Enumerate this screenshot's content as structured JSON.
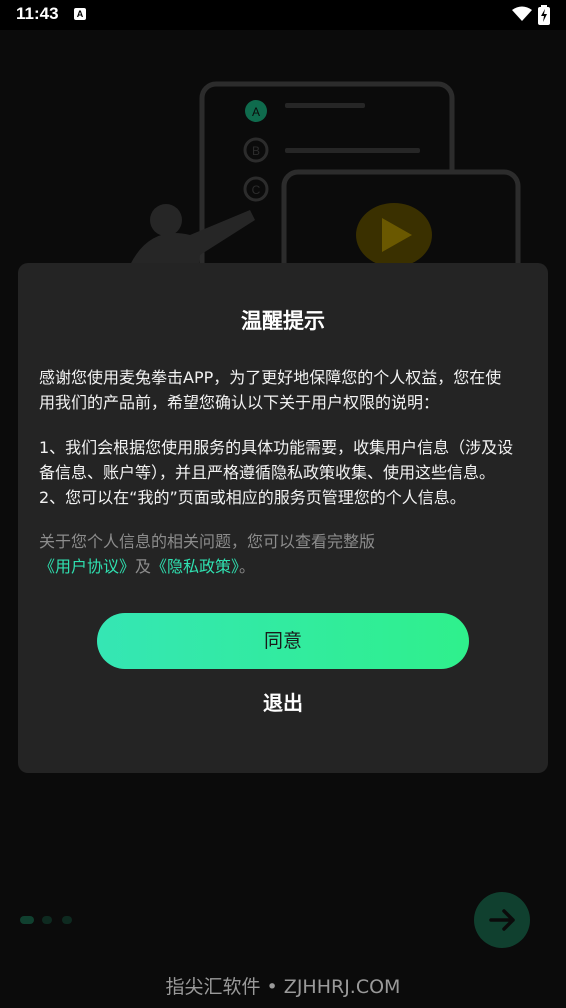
{
  "status_bar": {
    "time": "11:43",
    "notification_icon": "A"
  },
  "dialog": {
    "title": "温醒提示",
    "intro_line1": "感谢您使用麦兔拳击APP，为了更好地保障您的个人权益，您在使",
    "intro_line2": "用我们的产品前，希望您确认以下关于用户权限的说明：",
    "item1_line1": "1、我们会根据您使用服务的具体功能需要，收集用户信息（涉及设",
    "item1_line2": "备信息、账户等），并且严格遵循隐私政策收集、使用这些信息。",
    "item2": "2、您可以在“我的”页面或相应的服务页管理您的个人信息。",
    "note_line1": "关于您个人信息的相关问题，您可以查看完整版",
    "user_agreement_link": "《用户协议》",
    "and_text": "及",
    "privacy_policy_link": "《隐私政策》",
    "end_punct": "。",
    "agree_label": "同意",
    "exit_label": "退出"
  },
  "background": {
    "option_labels": [
      "A",
      "B",
      "C"
    ]
  },
  "pager": {
    "active_index": 0,
    "count": 3
  },
  "watermark": "指尖汇软件 • ZJHHRJ.COM",
  "colors": {
    "accent": "#2fe0b0",
    "button_gradient_start": "#35e6b4",
    "button_gradient_end": "#2ff08c",
    "dialog_bg": "#242424",
    "next_button_bg": "#10402f"
  }
}
